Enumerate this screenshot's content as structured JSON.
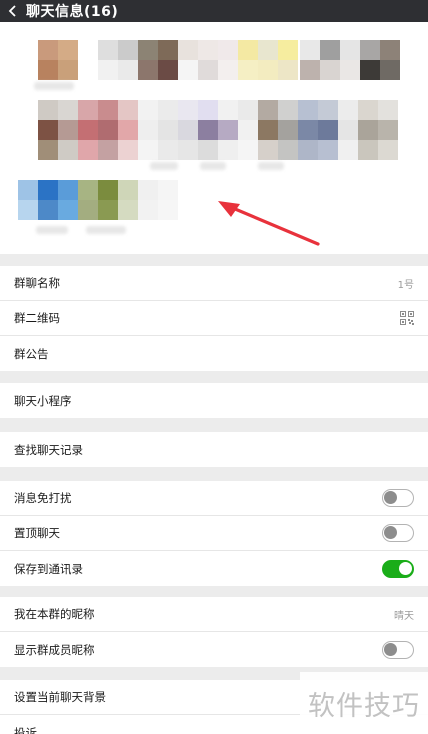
{
  "header": {
    "title": "聊天信息(16)",
    "back_icon": "chevron-left-icon"
  },
  "group": {
    "name_label": "群聊名称",
    "name_value": "1号",
    "qr_label": "群二维码",
    "qr_icon": "qr-code-icon",
    "notice_label": "群公告"
  },
  "mini": {
    "label": "聊天小程序"
  },
  "search": {
    "label": "查找聊天记录"
  },
  "settings": [
    {
      "key": "mute",
      "label": "消息免打扰",
      "on": false
    },
    {
      "key": "pin",
      "label": "置顶聊天",
      "on": false
    },
    {
      "key": "save",
      "label": "保存到通讯录",
      "on": true
    }
  ],
  "nickname": {
    "my_label": "我在本群的昵称",
    "my_value": "晴天",
    "show_label": "显示群成员昵称",
    "show_on": false
  },
  "bottom": {
    "bg_label": "设置当前聊天背景",
    "report_label": "投诉"
  },
  "watermark": "软件技巧",
  "colors": {
    "accent_green": "#1aad19",
    "titlebar": "#2e2f33"
  }
}
